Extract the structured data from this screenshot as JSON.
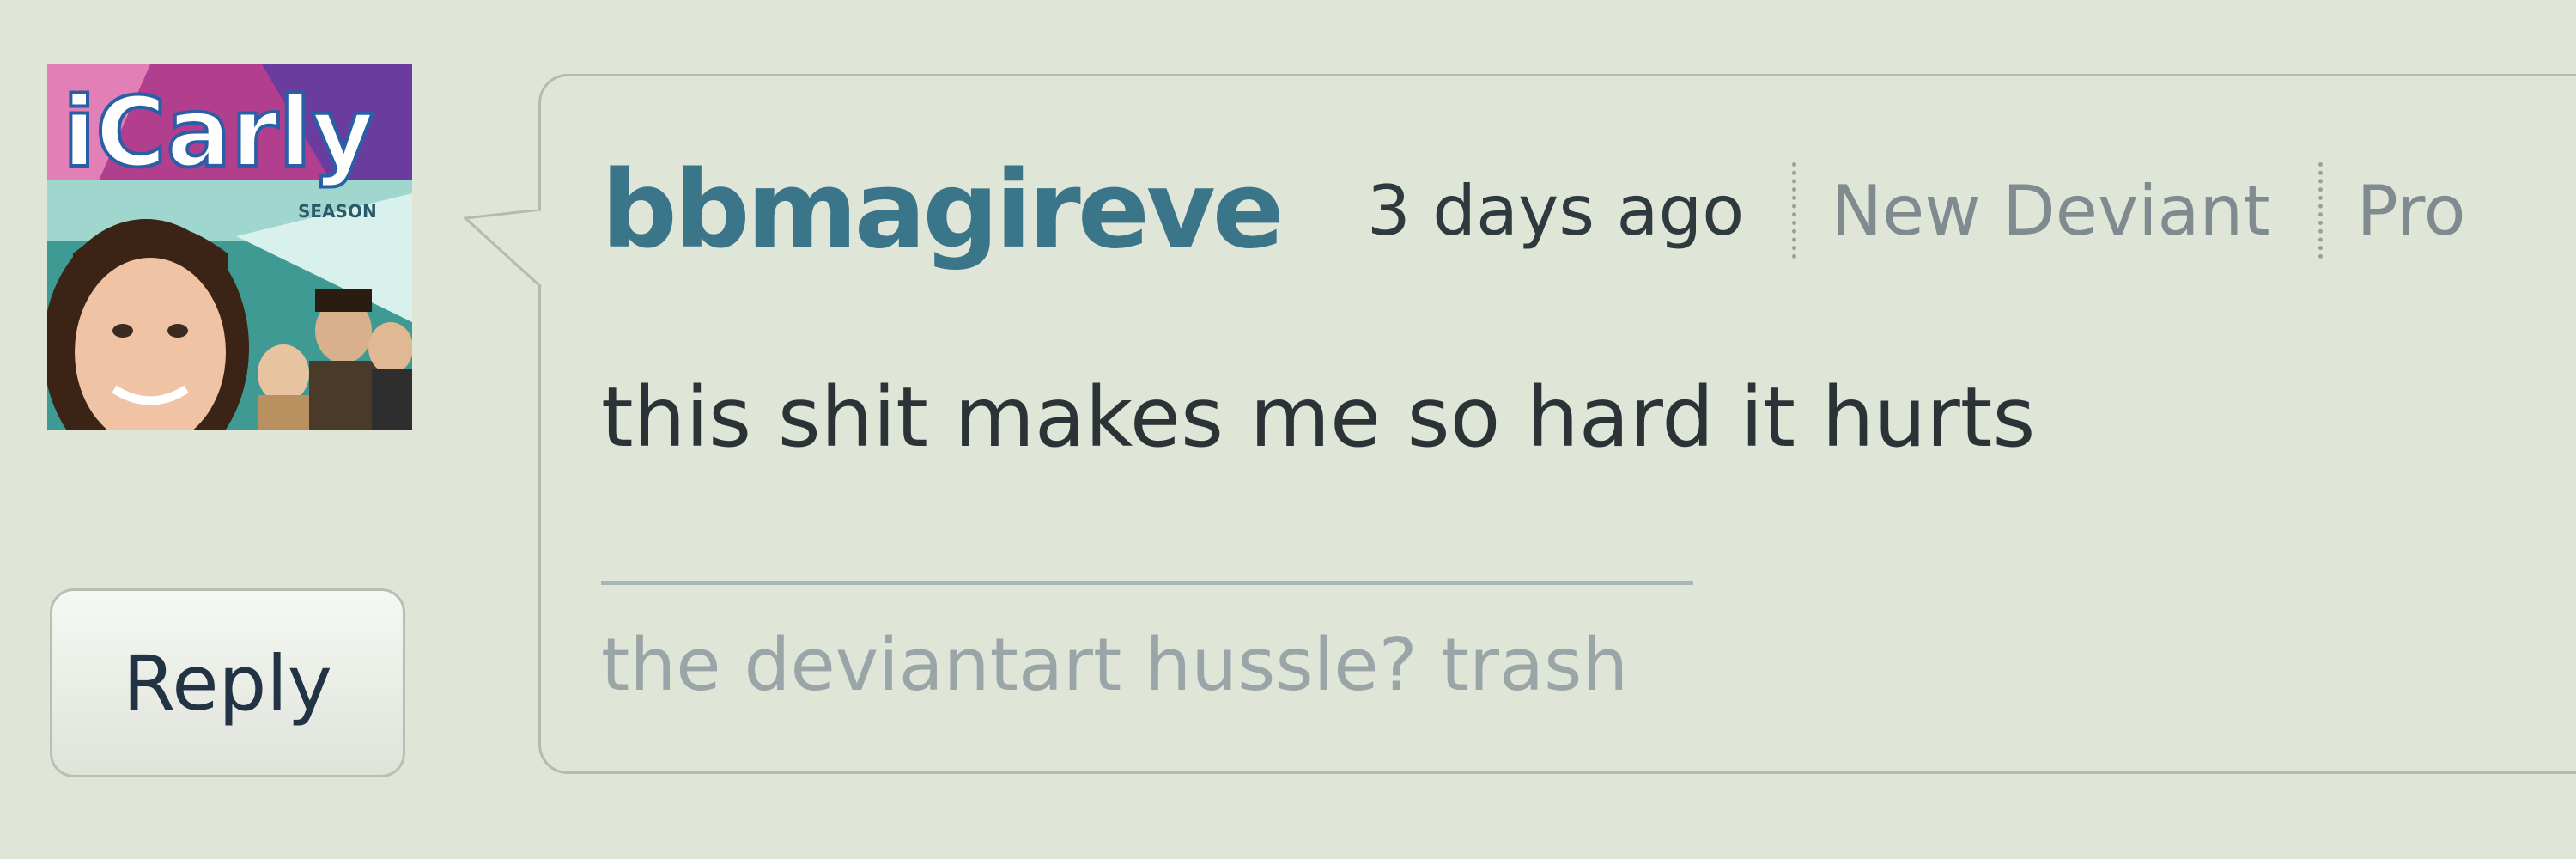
{
  "comment": {
    "avatar": {
      "icon": "user-avatar-icon",
      "logo_text": "iCarly",
      "season_text": "SEASON"
    },
    "username": "bbmagireve",
    "timestamp": "3 days ago",
    "badges": [
      "New Deviant",
      "Pro"
    ],
    "text": "this shit makes me so hard it hurts",
    "signature": "the deviantart hussle? trash",
    "reply_label": "Reply"
  },
  "colors": {
    "background": "#dfe5d7",
    "username": "#3b7589",
    "border": "#b4bcae",
    "muted": "#7f8b8e"
  }
}
